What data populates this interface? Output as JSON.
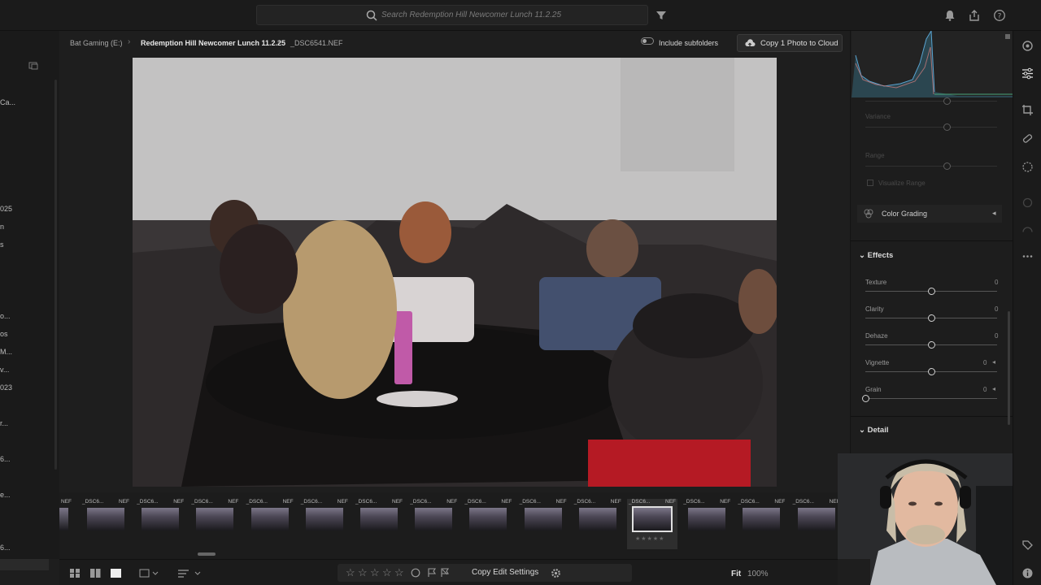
{
  "search": {
    "placeholder": "Search Redemption Hill Newcomer Lunch 11.2.25"
  },
  "breadcrumb": {
    "root": "Bat Gaming (E:)",
    "folder": "Redemption Hill Newcomer Lunch 11.2.25",
    "file": "_DSC6541.NEF"
  },
  "toolbar": {
    "subfolders_label": "Include subfolders",
    "copy_cloud_label": "Copy 1 Photo to Cloud"
  },
  "left_panel": {
    "items": [
      "Ca...",
      "025",
      "n",
      "s",
      "o...",
      "os",
      "M...",
      "v...",
      "023",
      "r...",
      "6...",
      "e...",
      "6..."
    ]
  },
  "right_panel": {
    "variance_label": "Variance",
    "range_label": "Range",
    "visualize_range_label": "Visualize Range",
    "color_grading_label": "Color Grading",
    "effects_label": "Effects",
    "detail_label": "Detail",
    "effects": [
      {
        "label": "Texture",
        "value": "0",
        "level": 0.5
      },
      {
        "label": "Clarity",
        "value": "0",
        "level": 0.5
      },
      {
        "label": "Dehaze",
        "value": "0",
        "level": 0.5
      },
      {
        "label": "Vignette",
        "value": "0",
        "level": 0.5
      },
      {
        "label": "Grain",
        "value": "0",
        "level": 0.0
      }
    ]
  },
  "filmstrip": {
    "first_ext": "NEF",
    "thumbs": [
      {
        "name": "_DSC6...",
        "ext": "NEF"
      },
      {
        "name": "_DSC6...",
        "ext": "NEF"
      },
      {
        "name": "_DSC6...",
        "ext": "NEF"
      },
      {
        "name": "_DSC6...",
        "ext": "NEF"
      },
      {
        "name": "_DSC6...",
        "ext": "NEF"
      },
      {
        "name": "_DSC6...",
        "ext": "NEF"
      },
      {
        "name": "_DSC6...",
        "ext": "NEF"
      },
      {
        "name": "_DSC6...",
        "ext": "NEF"
      },
      {
        "name": "_DSC6...",
        "ext": "NEF"
      },
      {
        "name": "_DSC6...",
        "ext": "NEF"
      },
      {
        "name": "_DSC6...",
        "ext": "NEF",
        "selected": true
      },
      {
        "name": "_DSC6...",
        "ext": "NEF"
      },
      {
        "name": "_DSC6...",
        "ext": "NEF"
      },
      {
        "name": "_DSC6...",
        "ext": "NEF"
      }
    ]
  },
  "bottom": {
    "copy_edit_label": "Copy Edit Settings",
    "fit_label": "Fit",
    "zoom_label": "100%"
  },
  "colors": {
    "accent": "#e0e0e0",
    "panel": "#1d1d1d"
  }
}
